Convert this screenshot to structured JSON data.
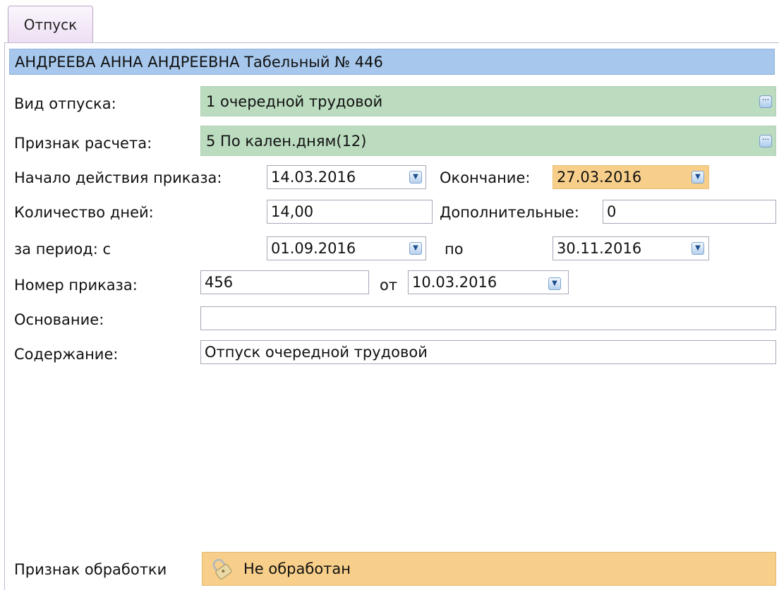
{
  "tab": {
    "label": "Отпуск"
  },
  "header": {
    "text": "АНДРЕЕВА АННА АНДРЕЕВНА  Табельный № 446"
  },
  "form": {
    "vacation_type": {
      "label": "Вид отпуска:",
      "value": "1  очередной трудовой"
    },
    "calc_sign": {
      "label": "Признак расчета:",
      "value": "5  По кален.дням(12)"
    },
    "start": {
      "label": "Начало действия приказа:",
      "value": "14.03.2016"
    },
    "end": {
      "label": "Окончание:",
      "value": "27.03.2016"
    },
    "days": {
      "label": "Количество дней:",
      "value": "14,00"
    },
    "additional": {
      "label": "Дополнительные:",
      "value": "0"
    },
    "period": {
      "label": "за период:  с",
      "from": "01.09.2016",
      "to_label": "по",
      "to": "30.11.2016"
    },
    "order_number": {
      "label": "Номер приказа:",
      "value": "456",
      "date_label": "от",
      "date": "10.03.2016"
    },
    "basis": {
      "label": "Основание:",
      "value": ""
    },
    "content": {
      "label": "Содержание:",
      "value": "Отпуск очередной трудовой"
    },
    "processing": {
      "label": "Признак обработки",
      "value": "Не обработан"
    }
  },
  "icons": {
    "ellipsis": "ellipsis-button-icon",
    "dropdown": "chevron-down-icon",
    "status": "lock-icon"
  },
  "colors": {
    "header_bg": "#a7c8ec",
    "lookup_bg": "#bcdcc0",
    "highlight_bg": "#f8cf8a"
  }
}
